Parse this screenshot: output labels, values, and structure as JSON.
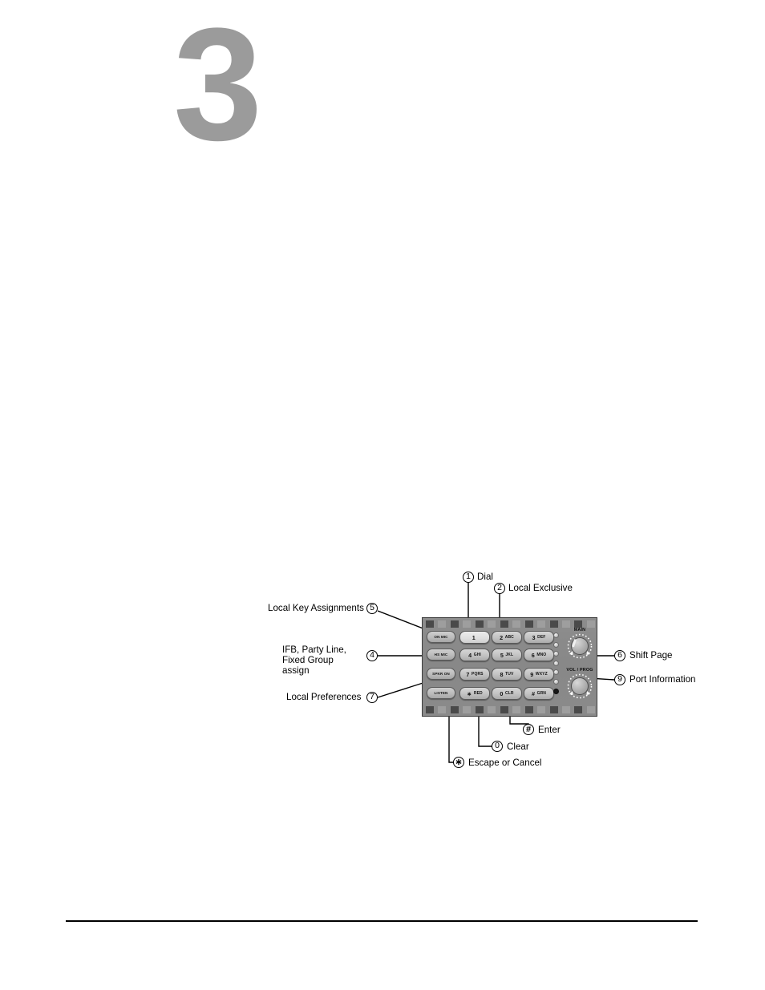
{
  "page": {
    "chapter_number": "3",
    "background_color": "#ffffff",
    "chapter_number_color": "#9b9b9b",
    "rule_color": "#000000"
  },
  "figure": {
    "device": "keypad",
    "keypad": {
      "function_keys": [
        {
          "label": "ON MIC"
        },
        {
          "label": "HS MIC"
        },
        {
          "label": "SPKR ON"
        },
        {
          "label": "LISTEN"
        }
      ],
      "number_keys": [
        {
          "digit": "1",
          "letters": "",
          "highlight": true
        },
        {
          "digit": "2",
          "letters": "ABC",
          "highlight": false
        },
        {
          "digit": "3",
          "letters": "DEF",
          "highlight": false
        },
        {
          "digit": "4",
          "letters": "GHI",
          "highlight": false
        },
        {
          "digit": "5",
          "letters": "JKL",
          "highlight": false
        },
        {
          "digit": "6",
          "letters": "MNO",
          "highlight": false
        },
        {
          "digit": "7",
          "letters": "PQRS",
          "highlight": false
        },
        {
          "digit": "8",
          "letters": "TUV",
          "highlight": false
        },
        {
          "digit": "9",
          "letters": "WXYZ",
          "highlight": false
        },
        {
          "digit": "∗",
          "letters": "RED",
          "highlight": false
        },
        {
          "digit": "0",
          "letters": "CLR",
          "highlight": false
        },
        {
          "digit": "#",
          "letters": "GRN",
          "highlight": false
        }
      ],
      "knobs": [
        {
          "label": "MAIN"
        },
        {
          "label": "VOL / PROG"
        }
      ],
      "led_count": 6,
      "indicator_dot": true
    },
    "callouts": [
      {
        "id": "1",
        "marker": "1",
        "text": "Dial",
        "side": "top"
      },
      {
        "id": "2",
        "marker": "2",
        "text": "Local Exclusive",
        "side": "top"
      },
      {
        "id": "5",
        "marker": "5",
        "text": "Local Key Assignments",
        "side": "left"
      },
      {
        "id": "4",
        "marker": "4",
        "text": "IFB, Party Line,\nFixed Group assign",
        "side": "left"
      },
      {
        "id": "7",
        "marker": "7",
        "text": "Local Preferences",
        "side": "left"
      },
      {
        "id": "6",
        "marker": "6",
        "text": "Shift Page",
        "side": "right"
      },
      {
        "id": "9",
        "marker": "9",
        "text": "Port Information",
        "side": "right"
      },
      {
        "id": "hash",
        "marker": "#",
        "text": "Enter",
        "side": "bottom"
      },
      {
        "id": "zero",
        "marker": "0",
        "text": "Clear",
        "side": "bottom"
      },
      {
        "id": "star",
        "marker": "∗",
        "text": "Escape or Cancel",
        "side": "bottom"
      }
    ],
    "callout_text": {
      "dial": "Dial",
      "local_exclusive": "Local Exclusive",
      "local_key_assignments": "Local Key Assignments",
      "ifb_line1": "IFB, Party Line,",
      "ifb_line2": "Fixed Group assign",
      "local_preferences": "Local Preferences",
      "shift_page": "Shift Page",
      "port_information": "Port Information",
      "enter": "Enter",
      "clear": "Clear",
      "escape_or_cancel": "Escape or Cancel"
    },
    "markers": {
      "m1": "1",
      "m2": "2",
      "m4": "4",
      "m5": "5",
      "m6": "6",
      "m7": "7",
      "m9": "9",
      "mhash": "#",
      "mstar": "∗"
    }
  }
}
